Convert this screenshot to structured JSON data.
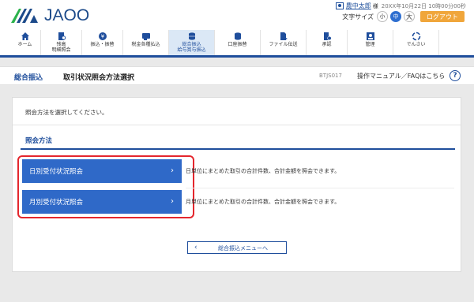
{
  "header": {
    "logo_text": "JAOO",
    "user_name": "農中太郎",
    "user_suffix": "様",
    "login_time": "20XX年10月22日 10時00分00秒",
    "font_size_label": "文字サイズ",
    "font_sizes": [
      "小",
      "中",
      "大"
    ],
    "active_font_size": "中",
    "logout_label": "ログアウト"
  },
  "nav": {
    "items": [
      {
        "label": "ホーム",
        "icon": "home-icon",
        "active": false
      },
      {
        "label": "残高\n明細照会",
        "icon": "document-search-icon",
        "active": false
      },
      {
        "label": "振込・振替",
        "icon": "yen-transfer-icon",
        "active": false
      },
      {
        "label": "税金各種払込",
        "icon": "payment-card-icon",
        "active": false
      },
      {
        "label": "総合振込\n給与賞与振込",
        "icon": "coins-stack-icon",
        "active": true
      },
      {
        "label": "口座振替",
        "icon": "coins-icon",
        "active": false
      },
      {
        "label": "ファイル伝送",
        "icon": "file-transfer-icon",
        "active": false
      },
      {
        "label": "承認",
        "icon": "approval-icon",
        "active": false
      },
      {
        "label": "管理",
        "icon": "admin-icon",
        "active": false
      },
      {
        "label": "でんさい",
        "icon": "densai-icon",
        "active": false
      }
    ]
  },
  "titlebar": {
    "section": "総合振込",
    "title": "取引状況照会方法選択",
    "screen_code": "BTJS017",
    "help_text": "操作マニュアル／FAQはこちら",
    "help_icon": "help-icon"
  },
  "content": {
    "instruction": "照会方法を選択してください。",
    "section_title": "照会方法",
    "options": [
      {
        "label": "日別受付状況照会",
        "description": "日単位にまとめた取引の合計件数、合計金額を照会できます。"
      },
      {
        "label": "月別受付状況照会",
        "description": "月単位にまとめた取引の合計件数、合計金額を照会できます。"
      }
    ],
    "back_button": "総合振込メニューへ"
  },
  "colors": {
    "brand_blue": "#1f4e9c",
    "button_blue": "#2f69c8",
    "logout_orange": "#f0a63b",
    "highlight_red": "#e4262d",
    "active_nav_bg": "#dbe8f6"
  }
}
